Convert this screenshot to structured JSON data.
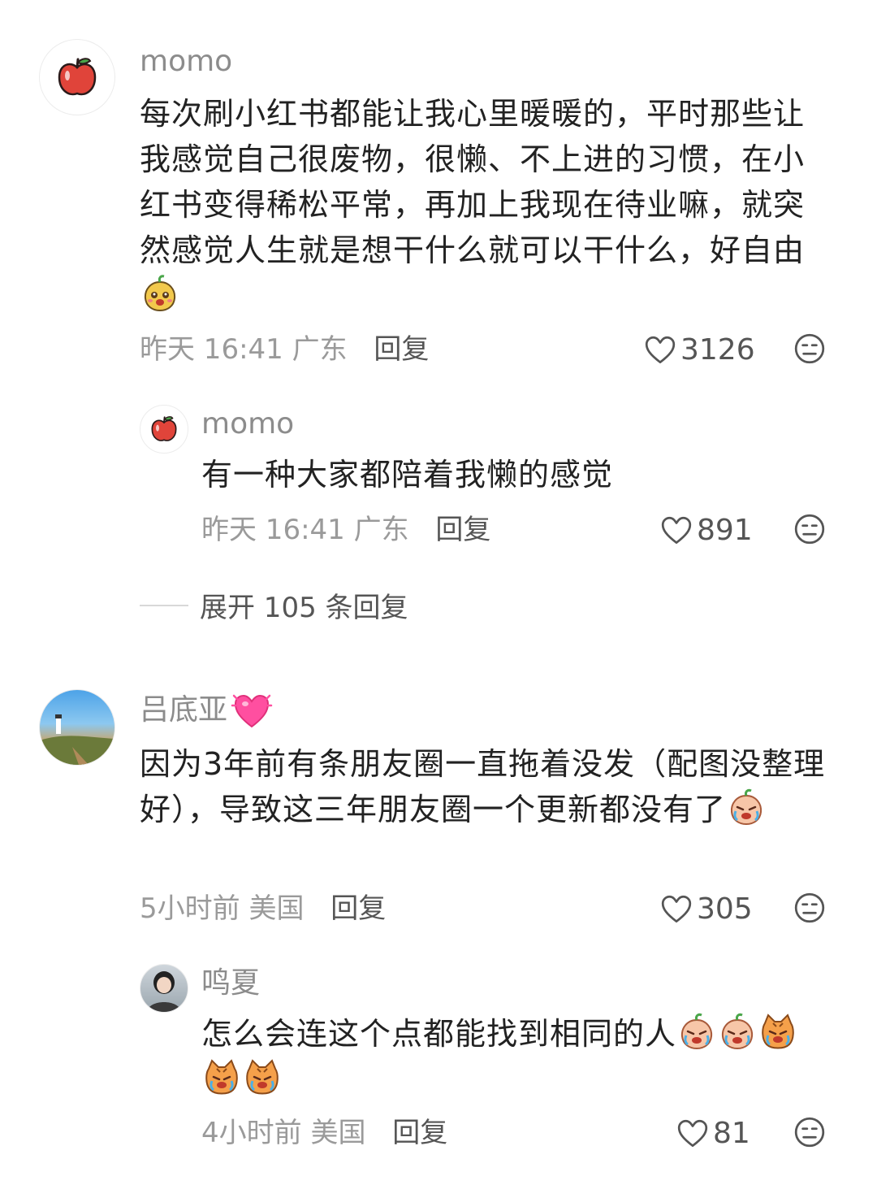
{
  "comments": [
    {
      "username": "momo",
      "text": "每次刷小红书都能让我心里暖暖的，平时那些让我感觉自己很废物，很懒、不上进的习惯，在小红书变得稀松平常，再加上我现在待业嘛，就突然感觉人生就是想干什么就可以干什么，好自由",
      "emoji": "yellow-face-emoji",
      "time": "昨天 16:41",
      "location": "广东",
      "reply_label": "回复",
      "likes": "3126",
      "reply": {
        "username": "momo",
        "text": "有一种大家都陪着我懒的感觉",
        "time": "昨天 16:41",
        "location": "广东",
        "reply_label": "回复",
        "likes": "891"
      },
      "expand_label": "展开 105 条回复"
    },
    {
      "username": "吕底亚",
      "text": "因为3年前有条朋友圈一直拖着没发（配图没整理好），导致这三年朋友圈一个更新都没有了",
      "emoji": "crying-face-emoji",
      "time": "5小时前",
      "location": "美国",
      "reply_label": "回复",
      "likes": "305",
      "reply": {
        "username": "鸣夏",
        "text": "怎么会连这个点都能找到相同的人",
        "emojis": [
          "crying-face-emoji",
          "crying-face-emoji",
          "crying-cat-emoji",
          "crying-cat-emoji",
          "crying-cat-emoji"
        ],
        "time": "4小时前",
        "location": "美国",
        "reply_label": "回复",
        "likes": "81"
      }
    }
  ]
}
